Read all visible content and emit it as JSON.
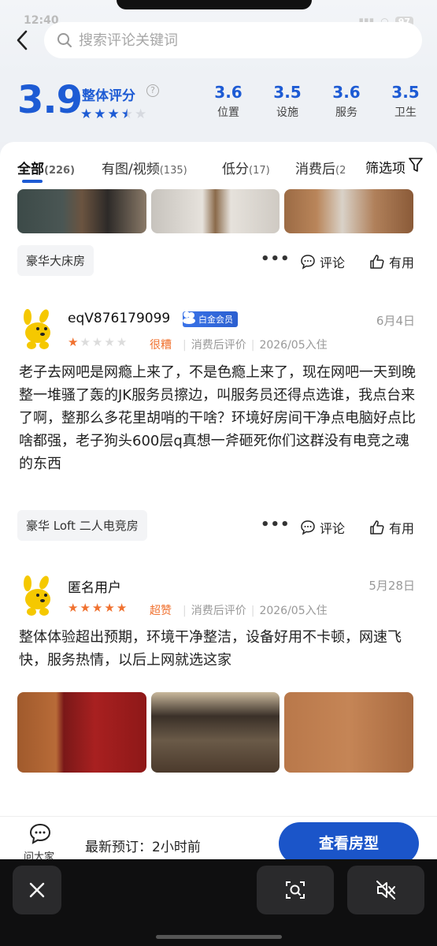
{
  "status": {
    "time": "12:40",
    "battery": "97"
  },
  "search": {
    "placeholder": "搜索评论关键词"
  },
  "rating": {
    "overall": "3.9",
    "overall_label": "整体评分",
    "stars": 3.5,
    "sub_scores": [
      {
        "value": "3.6",
        "label": "位置"
      },
      {
        "value": "3.5",
        "label": "设施"
      },
      {
        "value": "3.6",
        "label": "服务"
      },
      {
        "value": "3.5",
        "label": "卫生"
      }
    ]
  },
  "tabs": [
    {
      "label": "全部",
      "count": "(226)"
    },
    {
      "label": "有图/视频",
      "count": "(135)"
    },
    {
      "label": "低分",
      "count": "(17)"
    },
    {
      "label": "消费后",
      "count": "(2"
    }
  ],
  "filter_label": "筛选项",
  "actions": {
    "comment": "评论",
    "useful": "有用"
  },
  "reviews": [
    {
      "room": "豪华大床房"
    },
    {
      "user": "eqV876179099",
      "badge": "白金会员",
      "date": "6月4日",
      "stars": 1,
      "grade": "很糟",
      "meta_type": "消费后评价",
      "stay": "2026/05入住",
      "text": "老子去网吧是网瘾上来了，不是色瘾上来了，现在网吧一天到晚整一堆骚了轰的JK服务员擦边，叫服务员还得点选谁，我点台来了啊，整那么多花里胡哨的干啥？环境好房间干净点电脑好点比啥都强，老子狗头600层q真想一斧砸死你们这群没有电竞之魂的东西",
      "room": "豪华 Loft 二人电竞房"
    },
    {
      "user": "匿名用户",
      "date": "5月28日",
      "stars": 5,
      "grade": "超赞",
      "meta_type": "消费后评价",
      "stay": "2026/05入住",
      "text": "整体体验超出预期，环境干净整洁，设备好用不卡顿，网速飞快，服务热情，以后上网就选这家"
    }
  ],
  "bottom": {
    "ask_label": "问大家",
    "latest": "最新预订：2小时前",
    "view_button": "查看房型"
  }
}
